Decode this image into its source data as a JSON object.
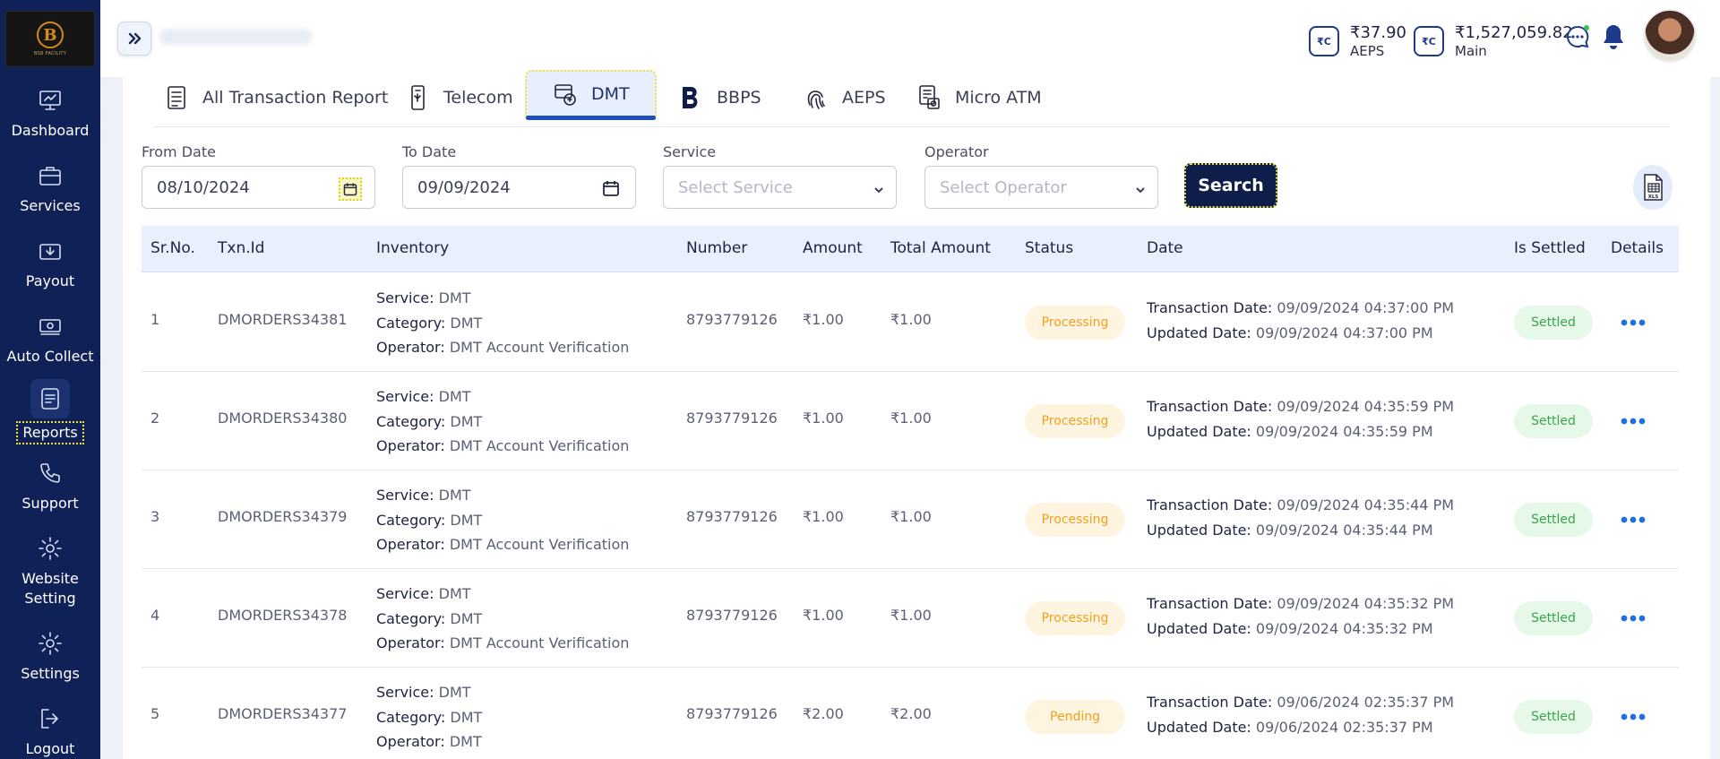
{
  "sidebar": {
    "logo_tag": "BSB FACILITY",
    "items": [
      {
        "label": "Dashboard"
      },
      {
        "label": "Services"
      },
      {
        "label": "Payout"
      },
      {
        "label": "Auto Collect"
      },
      {
        "label": "Reports"
      },
      {
        "label": "Support"
      },
      {
        "label": "Website Setting"
      },
      {
        "label": "Settings"
      },
      {
        "label": "Logout"
      }
    ]
  },
  "header": {
    "wallets": [
      {
        "icon": "₹C",
        "amount": "₹37.90",
        "label": "AEPS"
      },
      {
        "icon": "₹C",
        "amount": "₹1,527,059.82",
        "label": "Main"
      }
    ]
  },
  "tabs": [
    {
      "label": "All Transaction Report",
      "icon": "report-icon"
    },
    {
      "label": "Telecom",
      "icon": "mobile-icon"
    },
    {
      "label": "DMT",
      "icon": "money-transfer-icon",
      "active": true
    },
    {
      "label": "BBPS",
      "icon": "bbps-icon"
    },
    {
      "label": "AEPS",
      "icon": "fingerprint-icon"
    },
    {
      "label": "Micro ATM",
      "icon": "micro-atm-icon"
    }
  ],
  "filters": {
    "from_label": "From Date",
    "from_value": "08/10/2024",
    "to_label": "To Date",
    "to_value": "09/09/2024",
    "service_label": "Service",
    "service_placeholder": "Select Service",
    "operator_label": "Operator",
    "operator_placeholder": "Select Operator",
    "search_label": "Search",
    "export_icon": "xls-icon"
  },
  "table": {
    "headers": [
      "Sr.No.",
      "Txn.Id",
      "Inventory",
      "Number",
      "Amount",
      "Total Amount",
      "Status",
      "Date",
      "Is Settled",
      "Details"
    ],
    "inv_labels": {
      "service": "Service:",
      "category": "Category:",
      "operator": "Operator:"
    },
    "date_labels": {
      "txn": "Transaction Date:",
      "upd": "Updated Date:"
    },
    "rows": [
      {
        "sr": "1",
        "txn": "DMORDERS34381",
        "service": "DMT",
        "category": "DMT",
        "operator": "DMT Account Verification",
        "number": "8793779126",
        "amount": "₹1.00",
        "total": "₹1.00",
        "status": "Processing",
        "txn_date": "09/09/2024 04:37:00 PM",
        "upd_date": "09/09/2024 04:37:00 PM",
        "settled": "Settled"
      },
      {
        "sr": "2",
        "txn": "DMORDERS34380",
        "service": "DMT",
        "category": "DMT",
        "operator": "DMT Account Verification",
        "number": "8793779126",
        "amount": "₹1.00",
        "total": "₹1.00",
        "status": "Processing",
        "txn_date": "09/09/2024 04:35:59 PM",
        "upd_date": "09/09/2024 04:35:59 PM",
        "settled": "Settled"
      },
      {
        "sr": "3",
        "txn": "DMORDERS34379",
        "service": "DMT",
        "category": "DMT",
        "operator": "DMT Account Verification",
        "number": "8793779126",
        "amount": "₹1.00",
        "total": "₹1.00",
        "status": "Processing",
        "txn_date": "09/09/2024 04:35:44 PM",
        "upd_date": "09/09/2024 04:35:44 PM",
        "settled": "Settled"
      },
      {
        "sr": "4",
        "txn": "DMORDERS34378",
        "service": "DMT",
        "category": "DMT",
        "operator": "DMT Account Verification",
        "number": "8793779126",
        "amount": "₹1.00",
        "total": "₹1.00",
        "status": "Processing",
        "txn_date": "09/09/2024 04:35:32 PM",
        "upd_date": "09/09/2024 04:35:32 PM",
        "settled": "Settled"
      },
      {
        "sr": "5",
        "txn": "DMORDERS34377",
        "service": "DMT",
        "category": "DMT",
        "operator": "DMT",
        "number": "8793779126",
        "amount": "₹2.00",
        "total": "₹2.00",
        "status": "Pending",
        "txn_date": "09/06/2024 02:35:37 PM",
        "upd_date": "09/06/2024 02:35:37 PM",
        "settled": "Settled"
      }
    ]
  }
}
